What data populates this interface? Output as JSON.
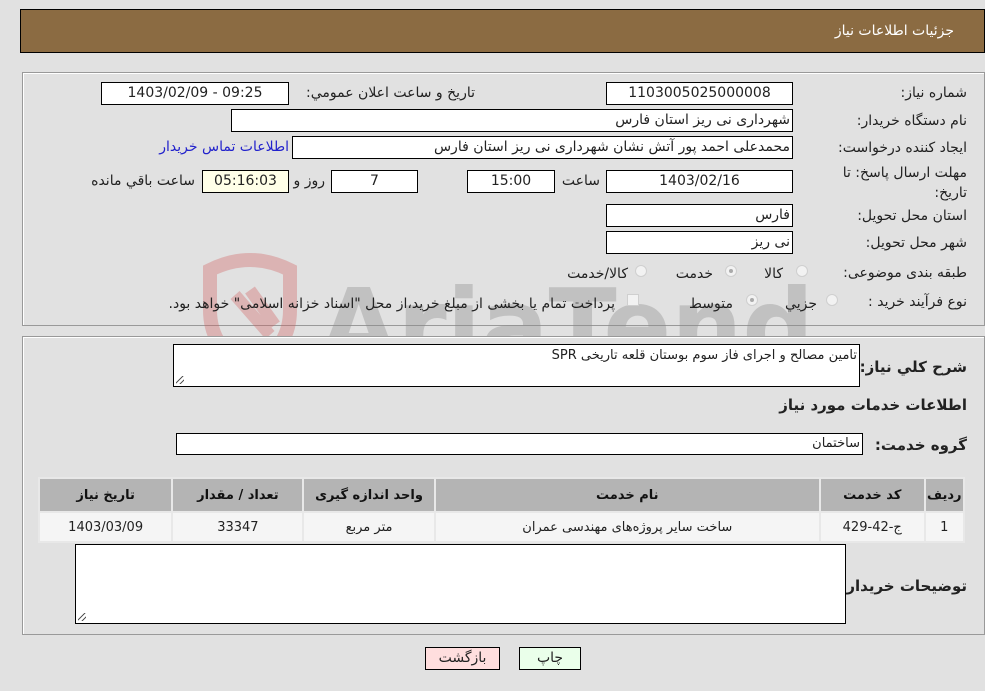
{
  "header": {
    "title": "جزئیات اطلاعات نیاز"
  },
  "form": {
    "need_number": {
      "label": "شماره نیاز:",
      "value": "1103005025000008"
    },
    "announce_datetime": {
      "label": "تاريخ و ساعت اعلان عمومي:",
      "value": "1403/02/09 - 09:25"
    },
    "buyer_org": {
      "label": "نام دستگاه خریدار:",
      "value": "شهرداری نی ریز استان فارس"
    },
    "requester": {
      "label": "ایجاد کننده درخواست:",
      "value": "محمدعلی احمد پور آتش نشان شهرداری نی ریز استان فارس"
    },
    "contact_link": "اطلاعات تماس خریدار",
    "deadline": {
      "label": "مهلت ارسال پاسخ: تا تاریخ:",
      "date": "1403/02/16",
      "time_label": "ساعت",
      "time": "15:00",
      "days": "7",
      "days_label": "روز و",
      "remaining": "05:16:03",
      "remaining_label": "ساعت باقي مانده"
    },
    "delivery_province": {
      "label": "استان محل تحویل:",
      "value": "فارس"
    },
    "delivery_city": {
      "label": "شهر محل تحویل:",
      "value": "نی ریز"
    },
    "category": {
      "label": "طبقه بندی موضوعی:",
      "options": [
        "کالا",
        "خدمت",
        "کالا/خدمت"
      ],
      "selected": "خدمت"
    },
    "purchase_type": {
      "label": "نوع فرآیند خرید :",
      "options": [
        "جزيي",
        "متوسط"
      ],
      "selected": "متوسط",
      "treasury_note": "پرداخت تمام یا بخشی از مبلغ خرید،از محل \"اسناد خزانه اسلامی\" خواهد بود."
    }
  },
  "details": {
    "description_label": "شرح کلي نياز:",
    "description": "تامین مصالح و اجرای فاز سوم بوستان قلعه تاریخی SPR",
    "services_title": "اطلاعات خدمات مورد نياز",
    "service_group_label": "گروه خدمت:",
    "service_group": "ساختمان",
    "table": {
      "headers": [
        "رديف",
        "کد خدمت",
        "نام خدمت",
        "واحد اندازه گيری",
        "تعداد / مقدار",
        "تاریخ نیاز"
      ],
      "rows": [
        [
          "1",
          "ج-42-429",
          "ساخت سایر پروژه‌های مهندسی عمران",
          "متر مربع",
          "33347",
          "1403/03/09"
        ]
      ]
    },
    "buyer_notes_label": "توضيحات خريدار:",
    "buyer_notes": ""
  },
  "buttons": {
    "print": "چاپ",
    "back": "بازگشت"
  },
  "watermark": "AriaTender.neT"
}
